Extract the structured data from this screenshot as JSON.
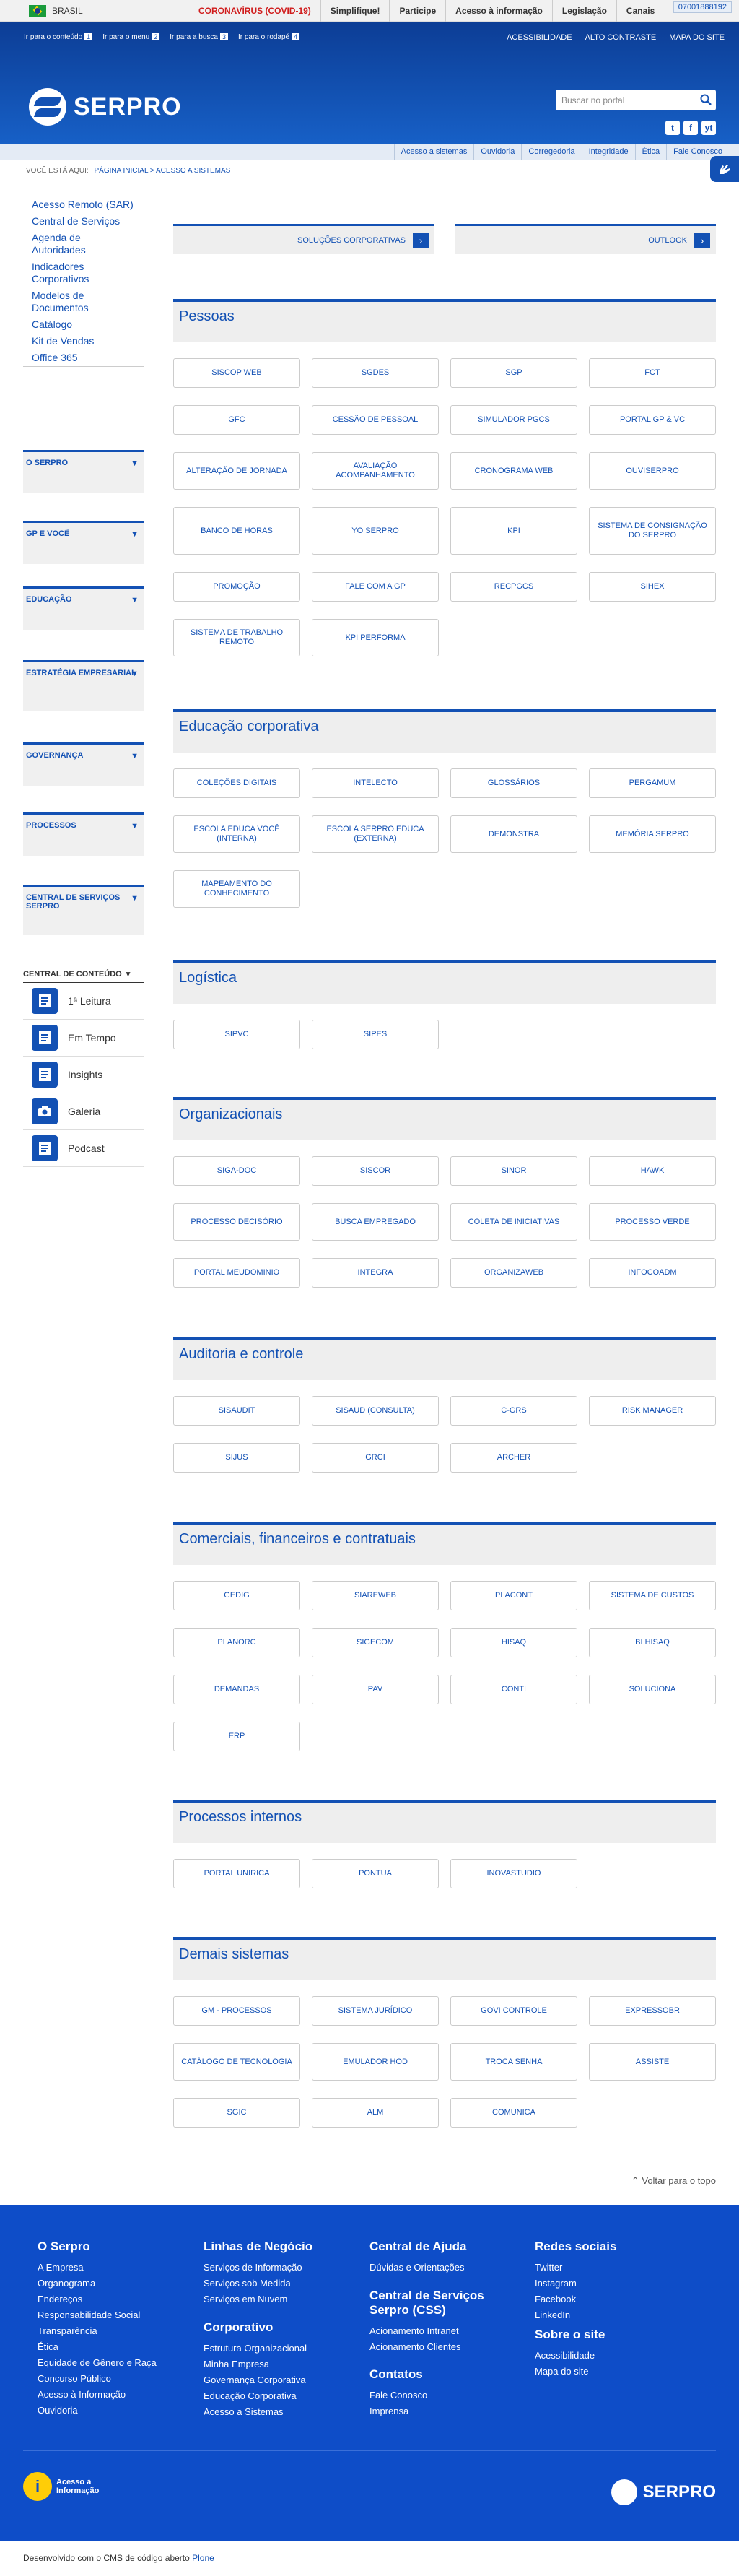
{
  "govbar": {
    "country": "BRASIL",
    "links": [
      "CORONAVÍRUS (COVID-19)",
      "Simplifique!",
      "Participe",
      "Acesso à informação",
      "Legislação",
      "Canais"
    ],
    "phone": "07001888192"
  },
  "header": {
    "accessibility": [
      {
        "label": "Ir para o conteúdo",
        "key": "1"
      },
      {
        "label": "Ir para o menu",
        "key": "2"
      },
      {
        "label": "Ir para a busca",
        "key": "3"
      },
      {
        "label": "Ir para o rodapé",
        "key": "4"
      }
    ],
    "toplinks": [
      "ACESSIBILIDADE",
      "ALTO CONTRASTE",
      "MAPA DO SITE"
    ],
    "logo": "SERPRO",
    "search_placeholder": "Buscar no portal",
    "social": [
      "t",
      "f",
      "yt"
    ]
  },
  "subnav": [
    "Acesso a sistemas",
    "Ouvidoria",
    "Corregedoria",
    "Integridade",
    "Ética",
    "Fale Conosco"
  ],
  "breadcrumb": {
    "label": "VOCÊ ESTÁ AQUI:",
    "path": "PÁGINA INICIAL > ACESSO A SISTEMAS"
  },
  "sidebar": {
    "links": [
      "Acesso Remoto (SAR)",
      "Central de Serviços",
      "Agenda de Autoridades",
      "Indicadores Corporativos",
      "Modelos de Documentos",
      "Catálogo",
      "Kit de Vendas",
      "Office 365"
    ],
    "sections": [
      "O SERPRO",
      "GP E VOCÊ",
      "EDUCAÇÃO",
      "ESTRATÉGIA EMPRESARIAL",
      "GOVERNANÇA",
      "PROCESSOS",
      "CENTRAL DE SERVIÇOS SERPRO"
    ],
    "content_center": {
      "title": "CENTRAL DE CONTEÚDO",
      "items": [
        "1ª Leitura",
        "Em Tempo",
        "Insights",
        "Galeria",
        "Podcast"
      ]
    }
  },
  "toptiles": [
    "SOLUÇÕES CORPORATIVAS",
    "OUTLOOK"
  ],
  "sections": [
    {
      "title": "Pessoas",
      "items": [
        "SISCOP WEB",
        "SGDES",
        "SGP",
        "FCT",
        "GFC",
        "CESSÃO DE PESSOAL",
        "SIMULADOR PGCS",
        "PORTAL GP & VC",
        "ALTERAÇÃO DE JORNADA",
        "AVALIAÇÃO ACOMPANHAMENTO",
        "CRONOGRAMA WEB",
        "OUVISERPRO",
        "BANCO DE HORAS",
        "YO SERPRO",
        "KPI",
        "SISTEMA DE CONSIGNAÇÃO DO SERPRO",
        "PROMOÇÃO",
        "FALE COM A GP",
        "RECPGCS",
        "SIHEX",
        "SISTEMA DE TRABALHO REMOTO",
        "KPI PERFORMA"
      ]
    },
    {
      "title": "Educação corporativa",
      "items": [
        "COLEÇÕES DIGITAIS",
        "INTELECTO",
        "GLOSSÁRIOS",
        "PERGAMUM",
        "ESCOLA EDUCA VOCÊ (INTERNA)",
        "ESCOLA SERPRO EDUCA (EXTERNA)",
        "DEMONSTRA",
        "MEMÓRIA SERPRO",
        "MAPEAMENTO DO CONHECIMENTO"
      ]
    },
    {
      "title": "Logística",
      "items": [
        "SIPVC",
        "SIPES"
      ]
    },
    {
      "title": "Organizacionais",
      "items": [
        "SIGA-DOC",
        "SISCOR",
        "SINOR",
        "HAWK",
        "PROCESSO DECISÓRIO",
        "BUSCA EMPREGADO",
        "COLETA DE INICIATIVAS",
        "PROCESSO VERDE",
        "PORTAL MEUDOMINIO",
        "INTEGRA",
        "ORGANIZAWEB",
        "INFOCOADM"
      ]
    },
    {
      "title": "Auditoria e controle",
      "items": [
        "SISAUDIT",
        "SISAUD (CONSULTA)",
        "C-GRS",
        "RISK MANAGER",
        "SIJUS",
        "GRCI",
        "ARCHER"
      ]
    },
    {
      "title": "Comerciais, financeiros e contratuais",
      "items": [
        "GEDIG",
        "SIAREWEB",
        "PLACONT",
        "SISTEMA DE CUSTOS",
        "PLANORC",
        "SIGECOM",
        "HISAQ",
        "BI HISAQ",
        "DEMANDAS",
        "PAV",
        "CONTI",
        "SOLUCIONA",
        "ERP"
      ]
    },
    {
      "title": "Processos internos",
      "items": [
        "PORTAL UNIRICA",
        "PONTUA",
        "INOVASTUDIO"
      ]
    },
    {
      "title": "Demais sistemas",
      "items": [
        "GM - PROCESSOS",
        "SISTEMA JURÍDICO",
        "GOVI CONTROLE",
        "EXPRESSOBR",
        "CATÁLOGO DE TECNOLOGIA",
        "EMULADOR HOD",
        "TROCA SENHA",
        "ASSISTE",
        "SGIC",
        "ALM",
        "COMUNICA"
      ]
    }
  ],
  "totop": "Voltar para o topo",
  "footer": {
    "cols": [
      {
        "title": "O Serpro",
        "links": [
          "A Empresa",
          "Organograma",
          "Endereços",
          "Responsabilidade Social",
          "Transparência",
          "Ética",
          "Equidade de Gênero e Raça",
          "Concurso Público",
          "Acesso à Informação",
          "Ouvidoria"
        ]
      },
      {
        "title": "Linhas de Negócio",
        "links": [
          "Serviços de Informação",
          "Serviços sob Medida",
          "Serviços em Nuvem"
        ]
      },
      {
        "title": "Corporativo",
        "links": [
          "Estrutura Organizacional",
          "Minha Empresa",
          "Governança Corporativa",
          "Educação Corporativa",
          "Acesso a Sistemas"
        ]
      },
      {
        "title": "Central de Ajuda",
        "links": [
          "Dúvidas e Orientações"
        ]
      },
      {
        "title": "Central de Serviços Serpro (CSS)",
        "links": [
          "Acionamento Intranet",
          "Acionamento Clientes"
        ]
      },
      {
        "title": "Contatos",
        "links": [
          "Fale Conosco",
          "Imprensa"
        ]
      },
      {
        "title": "Redes sociais",
        "links": [
          "Twitter",
          "Instagram",
          "Facebook",
          "LinkedIn"
        ]
      },
      {
        "title": "Sobre o site",
        "links": [
          "Acessibilidade",
          "Mapa do site"
        ]
      }
    ],
    "ai_label": "Acesso à Informação",
    "logo": "SERPRO",
    "bottom_text": "Desenvolvido com o CMS de código aberto",
    "bottom_link": "Plone"
  }
}
